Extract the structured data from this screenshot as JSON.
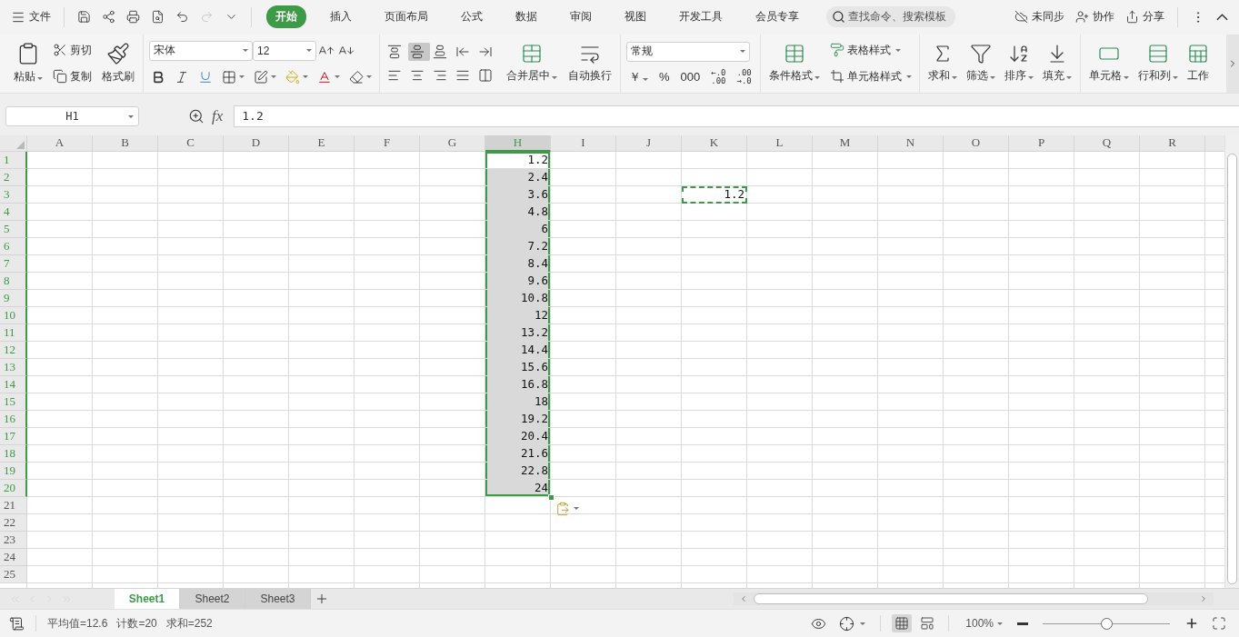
{
  "title_bar": {
    "file_menu": "文件",
    "quick_access": [
      {
        "disabled": false
      },
      {
        "disabled": false
      },
      {
        "disabled": false
      },
      {
        "disabled": false
      },
      {
        "disabled": false
      },
      {
        "disabled": true
      },
      {
        "disabled": false
      }
    ],
    "tabs": [
      {
        "label": "开始",
        "selected": true
      },
      {
        "label": "插入",
        "selected": false
      },
      {
        "label": "页面布局",
        "selected": false
      },
      {
        "label": "公式",
        "selected": false
      },
      {
        "label": "数据",
        "selected": false
      },
      {
        "label": "审阅",
        "selected": false
      },
      {
        "label": "视图",
        "selected": false
      },
      {
        "label": "开发工具",
        "selected": false
      },
      {
        "label": "会员专享",
        "selected": false
      }
    ],
    "search": {
      "placeholder": "查找命令、搜索模板"
    },
    "actions": [
      "未同步",
      "协作",
      "分享"
    ]
  },
  "ribbon": {
    "clipboard": {
      "paste": "粘贴",
      "cut": "剪切",
      "copy": "复制",
      "format_painter": "格式刷"
    },
    "font": {
      "name": "宋体",
      "size": "12"
    },
    "alignment": {
      "buttons": [
        {
          "selected": false
        },
        {
          "selected": true
        },
        {
          "selected": false
        },
        {
          "selected": false
        },
        {
          "selected": false
        },
        {
          "selected": false
        },
        {
          "selected": false
        },
        {
          "selected": false
        },
        {
          "selected": false
        },
        {
          "selected": false
        }
      ],
      "merge": "合并居中",
      "wrap": "自动换行"
    },
    "number": {
      "format": "常规",
      "currency": "￥",
      "percent": "%",
      "thousands": "000",
      "increase_decimal": [
        "←.0",
        ".00"
      ],
      "decrease_decimal": [
        ".00",
        "→.0"
      ]
    },
    "styles": {
      "conditional_format": "条件格式",
      "table_style": "表格样式",
      "cell_style": "单元格样式"
    },
    "editing": [
      {
        "label": "求和",
        "dropdown": true
      },
      {
        "label": "筛选",
        "dropdown": true
      },
      {
        "label": "排序",
        "dropdown": true
      },
      {
        "label": "填充",
        "dropdown": true
      }
    ],
    "cells": [
      {
        "label": "单元格",
        "dropdown": true
      },
      {
        "label": "行和列",
        "dropdown": true
      },
      {
        "label": "工作",
        "dropdown": false
      }
    ]
  },
  "formula_bar": {
    "name_box": "H1",
    "fx": "fx",
    "value": "1.2"
  },
  "sheet": {
    "columns": [
      {
        "label": "A",
        "selected": false
      },
      {
        "label": "B",
        "selected": false
      },
      {
        "label": "C",
        "selected": false
      },
      {
        "label": "D",
        "selected": false
      },
      {
        "label": "E",
        "selected": false
      },
      {
        "label": "F",
        "selected": false
      },
      {
        "label": "G",
        "selected": false
      },
      {
        "label": "H",
        "selected": true
      },
      {
        "label": "I",
        "selected": false
      },
      {
        "label": "J",
        "selected": false
      },
      {
        "label": "K",
        "selected": false
      },
      {
        "label": "L",
        "selected": false
      },
      {
        "label": "M",
        "selected": false
      },
      {
        "label": "N",
        "selected": false
      },
      {
        "label": "O",
        "selected": false
      },
      {
        "label": "P",
        "selected": false
      },
      {
        "label": "Q",
        "selected": false
      },
      {
        "label": "R",
        "selected": false
      }
    ],
    "rows": [
      {
        "label": "1",
        "selected": true,
        "cells": {
          "H": {
            "value": "1.2",
            "selected": true,
            "active": true,
            "copied": false
          }
        }
      },
      {
        "label": "2",
        "selected": true,
        "cells": {
          "H": {
            "value": "2.4",
            "selected": true,
            "active": false,
            "copied": false
          }
        }
      },
      {
        "label": "3",
        "selected": true,
        "cells": {
          "H": {
            "value": "3.6",
            "selected": true,
            "active": false,
            "copied": false
          },
          "K": {
            "value": "1.2",
            "selected": false,
            "active": false,
            "copied": true
          }
        }
      },
      {
        "label": "4",
        "selected": true,
        "cells": {
          "H": {
            "value": "4.8",
            "selected": true,
            "active": false,
            "copied": false
          }
        }
      },
      {
        "label": "5",
        "selected": true,
        "cells": {
          "H": {
            "value": "6",
            "selected": true,
            "active": false,
            "copied": false
          }
        }
      },
      {
        "label": "6",
        "selected": true,
        "cells": {
          "H": {
            "value": "7.2",
            "selected": true,
            "active": false,
            "copied": false
          }
        }
      },
      {
        "label": "7",
        "selected": true,
        "cells": {
          "H": {
            "value": "8.4",
            "selected": true,
            "active": false,
            "copied": false
          }
        }
      },
      {
        "label": "8",
        "selected": true,
        "cells": {
          "H": {
            "value": "9.6",
            "selected": true,
            "active": false,
            "copied": false
          }
        }
      },
      {
        "label": "9",
        "selected": true,
        "cells": {
          "H": {
            "value": "10.8",
            "selected": true,
            "active": false,
            "copied": false
          }
        }
      },
      {
        "label": "10",
        "selected": true,
        "cells": {
          "H": {
            "value": "12",
            "selected": true,
            "active": false,
            "copied": false
          }
        }
      },
      {
        "label": "11",
        "selected": true,
        "cells": {
          "H": {
            "value": "13.2",
            "selected": true,
            "active": false,
            "copied": false
          }
        }
      },
      {
        "label": "12",
        "selected": true,
        "cells": {
          "H": {
            "value": "14.4",
            "selected": true,
            "active": false,
            "copied": false
          }
        }
      },
      {
        "label": "13",
        "selected": true,
        "cells": {
          "H": {
            "value": "15.6",
            "selected": true,
            "active": false,
            "copied": false
          }
        }
      },
      {
        "label": "14",
        "selected": true,
        "cells": {
          "H": {
            "value": "16.8",
            "selected": true,
            "active": false,
            "copied": false
          }
        }
      },
      {
        "label": "15",
        "selected": true,
        "cells": {
          "H": {
            "value": "18",
            "selected": true,
            "active": false,
            "copied": false
          }
        }
      },
      {
        "label": "16",
        "selected": true,
        "cells": {
          "H": {
            "value": "19.2",
            "selected": true,
            "active": false,
            "copied": false
          }
        }
      },
      {
        "label": "17",
        "selected": true,
        "cells": {
          "H": {
            "value": "20.4",
            "selected": true,
            "active": false,
            "copied": false
          }
        }
      },
      {
        "label": "18",
        "selected": true,
        "cells": {
          "H": {
            "value": "21.6",
            "selected": true,
            "active": false,
            "copied": false
          }
        }
      },
      {
        "label": "19",
        "selected": true,
        "cells": {
          "H": {
            "value": "22.8",
            "selected": true,
            "active": false,
            "copied": false
          }
        }
      },
      {
        "label": "20",
        "selected": true,
        "cells": {
          "H": {
            "value": "24",
            "selected": true,
            "active": false,
            "copied": false
          }
        }
      },
      {
        "label": "21",
        "selected": false
      },
      {
        "label": "22",
        "selected": false
      },
      {
        "label": "23",
        "selected": false
      },
      {
        "label": "24",
        "selected": false
      },
      {
        "label": "25",
        "selected": false
      }
    ]
  },
  "sheet_tabs": [
    {
      "label": "Sheet1",
      "selected": true
    },
    {
      "label": "Sheet2",
      "selected": false
    },
    {
      "label": "Sheet3",
      "selected": false
    }
  ],
  "status_bar": {
    "stats": [
      "平均值=12.6",
      "计数=20",
      "求和=252"
    ],
    "views": [
      {
        "selected": true
      },
      {
        "selected": false
      }
    ],
    "zoom": "100%",
    "zoom_slider": {
      "level": 0.5
    }
  }
}
